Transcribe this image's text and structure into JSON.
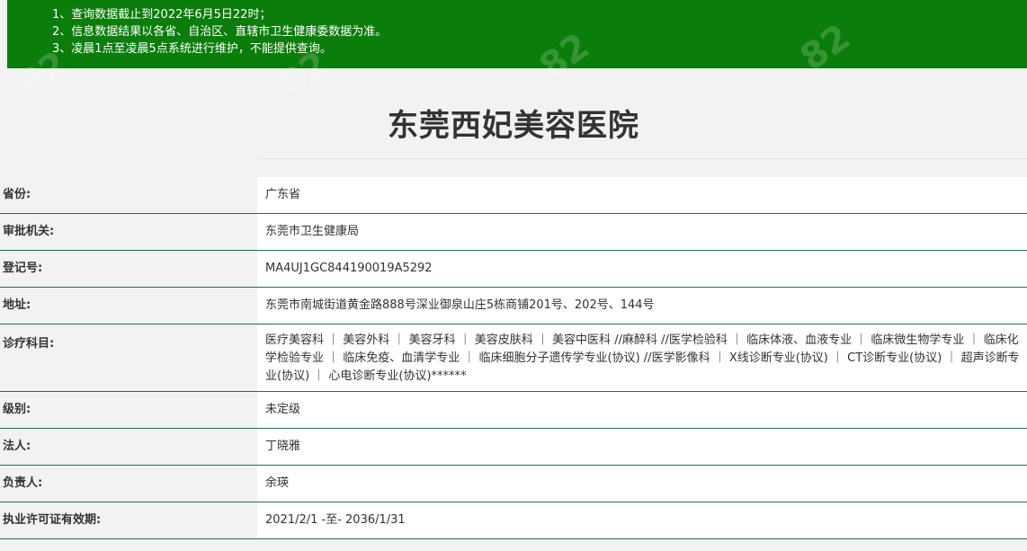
{
  "notice": {
    "lines": [
      "1、查询数据截止到2022年6月5日22时；",
      "2、信息数据结果以各省、自治区、直辖市卫生健康委数据为准。",
      "3、凌晨1点至凌晨5点系统进行维护，不能提供查询。"
    ]
  },
  "hospital": {
    "name": "东莞西妃美容医院"
  },
  "fields": [
    {
      "label": "省份:",
      "value": "广东省"
    },
    {
      "label": "审批机关:",
      "value": "东莞市卫生健康局"
    },
    {
      "label": "登记号:",
      "value": "MA4UJ1GC844190019A5292"
    },
    {
      "label": "地址:",
      "value": "东莞市南城街道黄金路888号深业御泉山庄5栋商铺201号、202号、144号"
    },
    {
      "label": "诊疗科目:",
      "value": "医疗美容科 ｜ 美容外科 ｜ 美容牙科 ｜ 美容皮肤科 ｜ 美容中医科 //麻醉科 //医学检验科 ｜ 临床体液、血液专业 ｜ 临床微生物学专业 ｜ 临床化学检验专业 ｜ 临床免疫、血清学专业 ｜ 临床细胞分子遗传学专业(协议) //医学影像科 ｜ X线诊断专业(协议) ｜ CT诊断专业(协议) ｜ 超声诊断专业(协议) ｜ 心电诊断专业(协议)******"
    },
    {
      "label": "级别:",
      "value": "未定级"
    },
    {
      "label": "法人:",
      "value": "丁晓雅"
    },
    {
      "label": "负责人:",
      "value": "余瑛"
    },
    {
      "label": "执业许可证有效期:",
      "value": "2021/2/1 -至- 2036/1/31"
    }
  ]
}
